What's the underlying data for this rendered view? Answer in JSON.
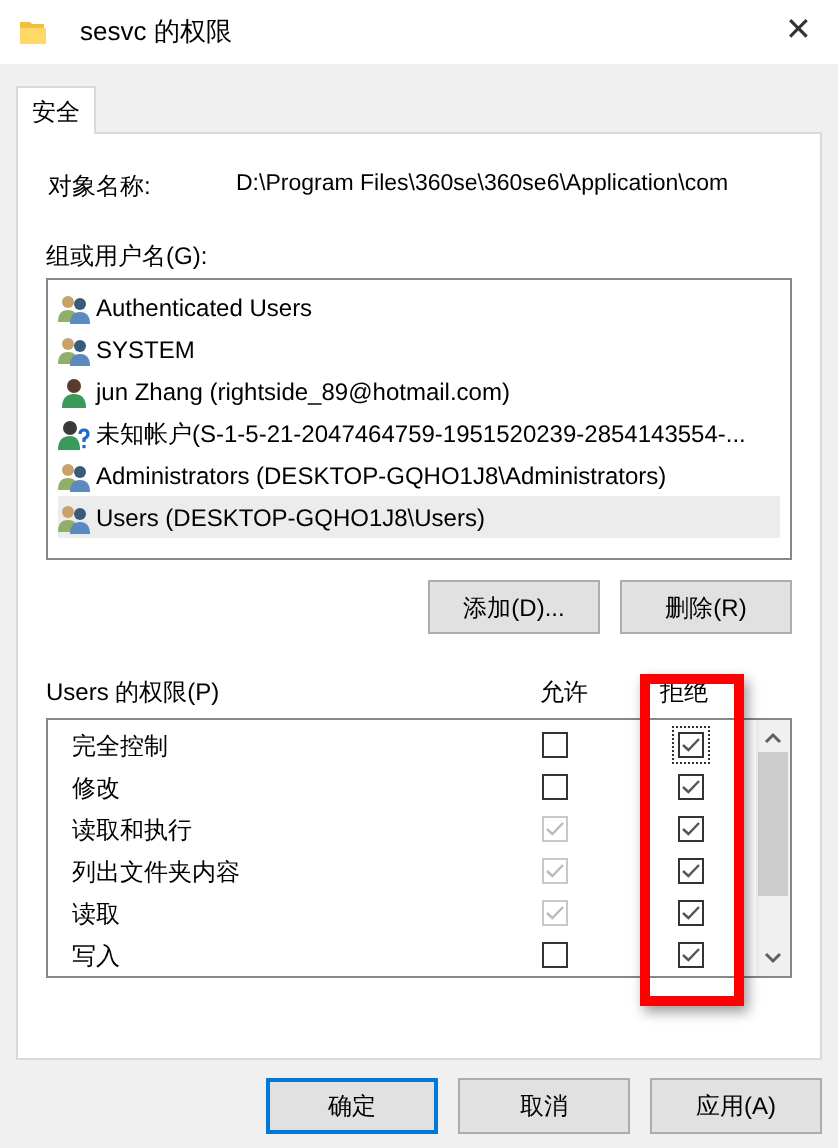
{
  "window": {
    "title": "sesvc 的权限",
    "close": "✕"
  },
  "tabs": [
    {
      "label": "安全",
      "selected": true
    }
  ],
  "object_name": {
    "label": "对象名称:",
    "value": "D:\\Program Files\\360se\\360se6\\Application\\com"
  },
  "groups": {
    "label": "组或用户名(G):",
    "items": [
      {
        "kind": "group",
        "name": "Authenticated Users",
        "selected": false
      },
      {
        "kind": "group",
        "name": "SYSTEM",
        "selected": false
      },
      {
        "kind": "user",
        "name": "jun Zhang (rightside_89@hotmail.com)",
        "selected": false
      },
      {
        "kind": "unknown",
        "name": "未知帐户(S-1-5-21-2047464759-1951520239-2854143554-...",
        "selected": false
      },
      {
        "kind": "group",
        "name": "Administrators (DESKTOP-GQHO1J8\\Administrators)",
        "selected": false
      },
      {
        "kind": "group",
        "name": "Users (DESKTOP-GQHO1J8\\Users)",
        "selected": true
      }
    ],
    "buttons": [
      "添加(D)...",
      "删除(R)"
    ]
  },
  "permissions": {
    "label": "Users 的权限(P)",
    "allow_header": "允许",
    "deny_header": "拒绝",
    "rows": [
      {
        "name": "完全控制",
        "allow": {
          "checked": false,
          "disabled": false
        },
        "deny": {
          "checked": true,
          "focused": true
        }
      },
      {
        "name": "修改",
        "allow": {
          "checked": false,
          "disabled": false
        },
        "deny": {
          "checked": true,
          "focused": false
        }
      },
      {
        "name": "读取和执行",
        "allow": {
          "checked": true,
          "disabled": true
        },
        "deny": {
          "checked": true,
          "focused": false
        }
      },
      {
        "name": "列出文件夹内容",
        "allow": {
          "checked": true,
          "disabled": true
        },
        "deny": {
          "checked": true,
          "focused": false
        }
      },
      {
        "name": "读取",
        "allow": {
          "checked": true,
          "disabled": true
        },
        "deny": {
          "checked": true,
          "focused": false
        }
      },
      {
        "name": "写入",
        "allow": {
          "checked": false,
          "disabled": false
        },
        "deny": {
          "checked": true,
          "focused": false
        }
      }
    ]
  },
  "footer_buttons": [
    {
      "label": "确定",
      "default": true
    },
    {
      "label": "取消",
      "default": false
    },
    {
      "label": "应用(A)",
      "default": false
    }
  ]
}
